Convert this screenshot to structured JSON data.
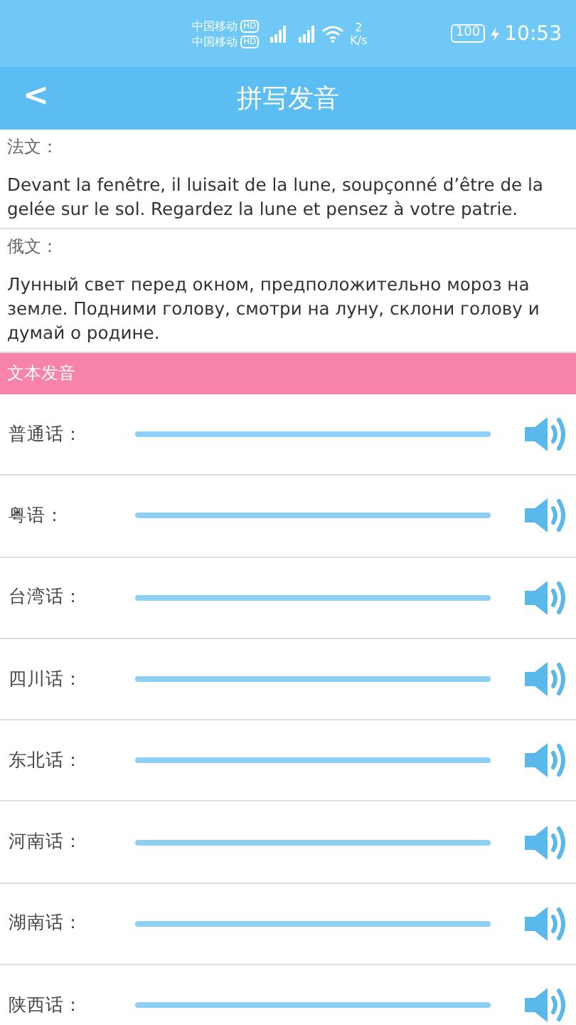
{
  "status_bar": {
    "carriers": [
      {
        "name": "中国移动",
        "badge": "HD"
      },
      {
        "name": "中国移动",
        "badge": "HD"
      }
    ],
    "network_speed": [
      "2",
      "K/s"
    ],
    "battery": "100",
    "time": "10:53"
  },
  "header": {
    "back_icon": "<",
    "title": "拼写发音"
  },
  "translations": [
    {
      "label": "法文：",
      "text": "Devant la fenêtre, il luisait de la lune, soupçonné d’être de la gelée sur le sol. Regardez la lune et pensez à votre patrie."
    },
    {
      "label": "俄文：",
      "text": "Лунный свет перед окном, предположительно мороз на земле. Подними голову, смотри на луну, склони голову и думай о родине."
    }
  ],
  "section_title": "文本发音",
  "dialects": [
    {
      "name": "普通话："
    },
    {
      "name": "粤语："
    },
    {
      "name": "台湾话："
    },
    {
      "name": "四川话："
    },
    {
      "name": "东北话："
    },
    {
      "name": "河南话："
    },
    {
      "name": "湖南话："
    },
    {
      "name": "陕西话："
    }
  ]
}
